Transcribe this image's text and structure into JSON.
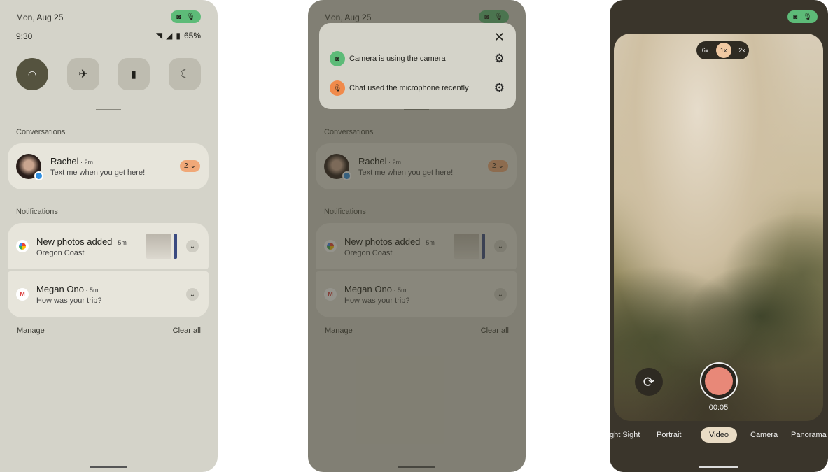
{
  "shade": {
    "date": "Mon, Aug 25",
    "time": "9:30",
    "battery": "65%",
    "tiles": [
      {
        "icon": "wifi-icon",
        "on": true
      },
      {
        "icon": "airplane-icon",
        "on": false
      },
      {
        "icon": "battery-saver-icon",
        "on": false
      },
      {
        "icon": "dark-mode-icon",
        "on": false
      }
    ],
    "conversations_label": "Conversations",
    "conversation": {
      "name": "Rachel",
      "time": "2m",
      "message": "Text me when you get here!",
      "count": "2"
    },
    "notifications_label": "Notifications",
    "notifications": [
      {
        "app": "photos",
        "title": "New photos added",
        "time": "5m",
        "text": "Oregon Coast"
      },
      {
        "app": "gmail",
        "title": "Megan Ono",
        "time": "5m",
        "text": "How was your trip?"
      }
    ],
    "manage": "Manage",
    "clear_all": "Clear all"
  },
  "privacy_popup": {
    "items": [
      {
        "text": "Camera is using the camera",
        "icon": "camera-icon",
        "color": "#5dbb78"
      },
      {
        "text": "Chat used the microphone recently",
        "icon": "microphone-icon",
        "color": "#f08a4b"
      }
    ]
  },
  "camera": {
    "zoom_levels": [
      ".6x",
      "1x",
      "2x"
    ],
    "selected_zoom": "1x",
    "timer": "00:05",
    "modes": [
      "ght Sight",
      "Portrait",
      "Video",
      "Camera",
      "Panorama"
    ],
    "active_mode": "Video"
  },
  "colors": {
    "privacy_green": "#5dbb78",
    "mic_orange": "#f08a4b",
    "record": "#e88878"
  }
}
